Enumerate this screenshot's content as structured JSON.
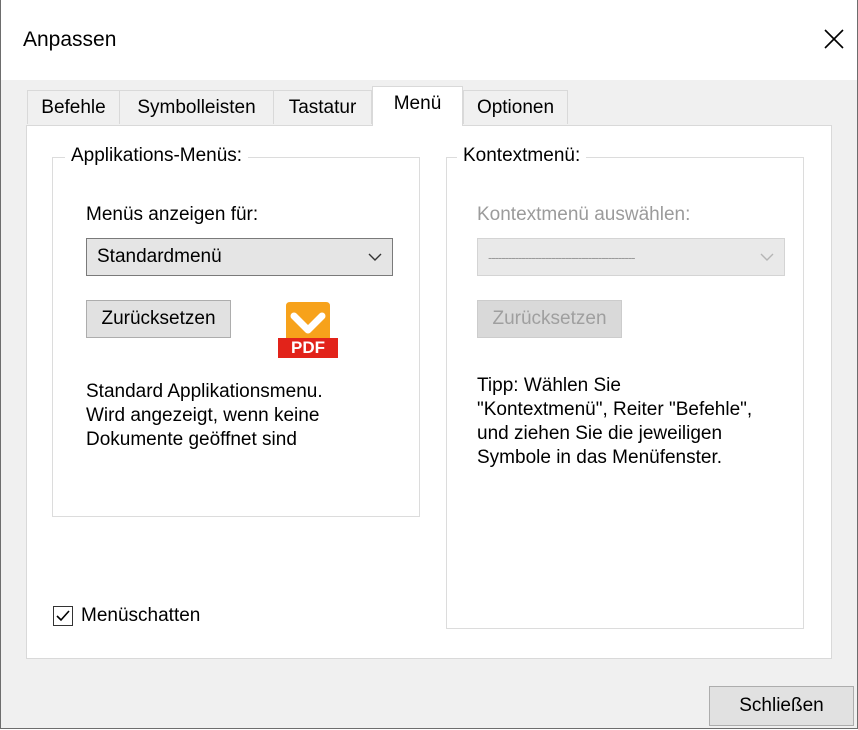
{
  "dialog": {
    "title": "Anpassen"
  },
  "tabs": [
    {
      "label": "Befehle"
    },
    {
      "label": "Symbolleisten"
    },
    {
      "label": "Tastatur"
    },
    {
      "label": "Menü",
      "active": true
    },
    {
      "label": "Optionen"
    }
  ],
  "app_menus": {
    "legend": "Applikations-Menüs:",
    "show_for_label": "Menüs anzeigen für:",
    "selected_menu": "Standardmenü",
    "reset_label": "Zurücksetzen",
    "logo_text": "PDF",
    "description": [
      "Standard Applikationsmenu.",
      "Wird angezeigt, wenn keine",
      "Dokumente geöffnet sind"
    ]
  },
  "context_menu": {
    "legend": "Kontextmenü:",
    "select_label": "Kontextmenü auswählen:",
    "selected_value": "--------------------------------------------",
    "reset_label": "Zurücksetzen",
    "tip": [
      "Tipp: Wählen Sie",
      "\"Kontextmenü\", Reiter \"Befehle\",",
      "und ziehen Sie die jeweiligen",
      "Symbole in das Menüfenster."
    ]
  },
  "menu_shadow": {
    "label": "Menüschatten",
    "checked": true
  },
  "footer": {
    "close_label": "Schließen"
  },
  "colors": {
    "logo_orange": "#f7a21b",
    "logo_red": "#e2231a",
    "dialog_bg": "#f0f0f0"
  }
}
